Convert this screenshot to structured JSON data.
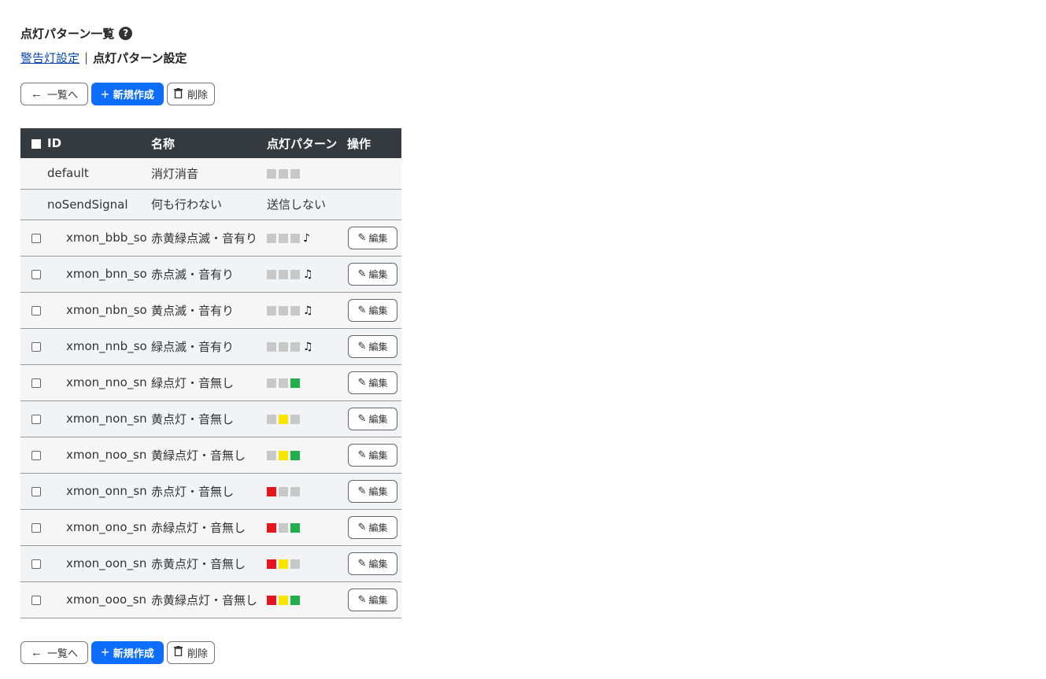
{
  "header": {
    "title": "点灯パターン一覧",
    "help_icon": "?"
  },
  "breadcrumb": {
    "link": "警告灯設定",
    "separator": "|",
    "current": "点灯パターン設定"
  },
  "toolbar": {
    "back_icon": "←",
    "back_label": "一覧へ",
    "new_icon": "+",
    "new_label": "新規作成",
    "delete_icon": "🗑",
    "delete_label": "削除"
  },
  "table": {
    "columns": {
      "id": "ID",
      "name": "名称",
      "pattern": "点灯パターン",
      "operation": "操作"
    },
    "edit_icon": "✎",
    "edit_label": "編集",
    "system_rows": [
      {
        "id": "default",
        "name": "消灯消音",
        "pattern_text": "",
        "lamps": [
          "off",
          "off",
          "off"
        ]
      },
      {
        "id": "noSendSignal",
        "name": "何も行わない",
        "pattern_text": "送信しない",
        "lamps": []
      }
    ],
    "rows": [
      {
        "id": "xmon_bbb_so",
        "name": "赤黄緑点滅・音有り",
        "lamps": [
          "off",
          "off",
          "off"
        ],
        "sound": "♪"
      },
      {
        "id": "xmon_bnn_so",
        "name": "赤点滅・音有り",
        "lamps": [
          "off",
          "off",
          "off"
        ],
        "sound": "♫"
      },
      {
        "id": "xmon_nbn_so",
        "name": "黄点滅・音有り",
        "lamps": [
          "off",
          "off",
          "off"
        ],
        "sound": "♫"
      },
      {
        "id": "xmon_nnb_so",
        "name": "緑点滅・音有り",
        "lamps": [
          "off",
          "off",
          "off"
        ],
        "sound": "♫"
      },
      {
        "id": "xmon_nno_sn",
        "name": "緑点灯・音無し",
        "lamps": [
          "off",
          "off",
          "green"
        ],
        "sound": ""
      },
      {
        "id": "xmon_non_sn",
        "name": "黄点灯・音無し",
        "lamps": [
          "off",
          "yellow",
          "off"
        ],
        "sound": ""
      },
      {
        "id": "xmon_noo_sn",
        "name": "黄緑点灯・音無し",
        "lamps": [
          "off",
          "yellow",
          "green"
        ],
        "sound": ""
      },
      {
        "id": "xmon_onn_sn",
        "name": "赤点灯・音無し",
        "lamps": [
          "red",
          "off",
          "off"
        ],
        "sound": ""
      },
      {
        "id": "xmon_ono_sn",
        "name": "赤緑点灯・音無し",
        "lamps": [
          "red",
          "off",
          "green"
        ],
        "sound": ""
      },
      {
        "id": "xmon_oon_sn",
        "name": "赤黄点灯・音無し",
        "lamps": [
          "red",
          "yellow",
          "off"
        ],
        "sound": ""
      },
      {
        "id": "xmon_ooo_sn",
        "name": "赤黄緑点灯・音無し",
        "lamps": [
          "red",
          "yellow",
          "green"
        ],
        "sound": ""
      }
    ]
  },
  "colors": {
    "header_bg": "#343a40",
    "primary": "#0d6efd",
    "lamp_off": "#c8c8c8",
    "lamp_red": "#e8141c",
    "lamp_yellow": "#f9e600",
    "lamp_green": "#1fb04b"
  }
}
